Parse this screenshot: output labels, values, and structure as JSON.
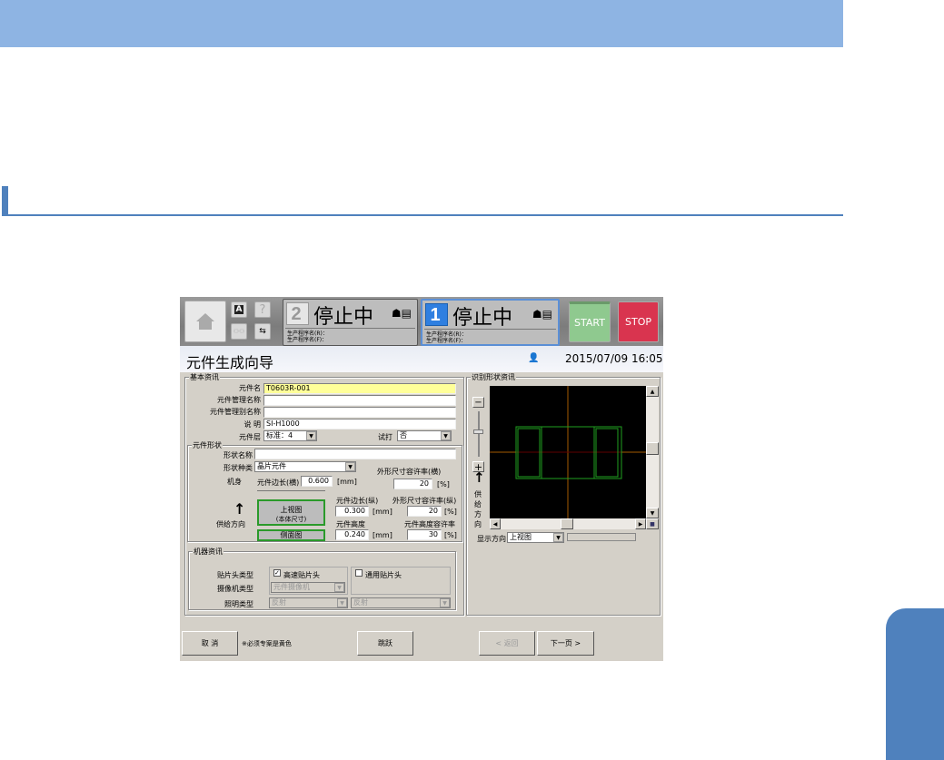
{
  "machine": {
    "lane2": {
      "number": "2",
      "status": "停止中",
      "prog_r": "生产程序名(R)：",
      "prog_f": "生产程序名(F)："
    },
    "lane1": {
      "number": "1",
      "status": "停止中",
      "prog_r": "生产程序名(R)：",
      "prog_f": "生产程序名(F)："
    },
    "start_label": "START",
    "stop_label": "STOP",
    "help_label": "?",
    "a_label": "A"
  },
  "header": {
    "title": "元件生成向导",
    "datetime": "2015/07/09 16:05"
  },
  "basic": {
    "group": "基本资讯",
    "part_name_label": "元件名",
    "part_name": "T0603R-001",
    "mgmt_name_label": "元件管理名称",
    "mgmt_name": "",
    "mgmt_alias_label": "元件管理别名称",
    "mgmt_alias": "",
    "desc_label": "说 明",
    "desc": "SI-H1000",
    "layer_label": "元件层",
    "layer": "标准：4",
    "trial_label": "试打",
    "trial": "否"
  },
  "shape": {
    "group": "元件形状",
    "shape_name_label": "形状名称",
    "shape_name": "",
    "shape_type_label": "形状种类",
    "shape_type": "晶片元件",
    "body_label": "机身",
    "len_h_label": "元件边长(横)",
    "len_h": "0.600",
    "mm": "[mm]",
    "tol_h_label": "外形尺寸容许率(横)",
    "tol_h": "20",
    "pct": "[%]",
    "len_v_label": "元件边长(纵)",
    "len_v": "0.300",
    "tol_v_label": "外形尺寸容许率(纵)",
    "tol_v": "20",
    "height_label": "元件高度",
    "height": "0.240",
    "tol_height_label": "元件高度容许率",
    "tol_height": "30",
    "top_view": "上视图",
    "top_view_sub": "(本体尺寸)",
    "side_view": "侧面图",
    "feed_dir": "供给方向"
  },
  "machine_info": {
    "group": "机器资讯",
    "head_type_label": "贴片头类型",
    "head_fast": "高速贴片头",
    "head_general": "通用贴片头",
    "camera_label": "摄像机类型",
    "camera": "元件摄像机",
    "light_label": "照明类型",
    "light1": "反射",
    "light2": "反射"
  },
  "recog": {
    "group": "识别形状资讯",
    "feed_dir_v": "供给方向",
    "display_dir_label": "显示方向",
    "display_dir": "上视图"
  },
  "footer": {
    "cancel": "取 消",
    "note": "※必须专案是黄色",
    "skip": "跳跃",
    "back": "< 返回",
    "next": "下一页 >"
  },
  "colors": {
    "band": "#8eb4e3",
    "accent": "#4f81bd",
    "start": "#8fc98f",
    "stop": "#d9344f",
    "required": "#ffff99"
  }
}
